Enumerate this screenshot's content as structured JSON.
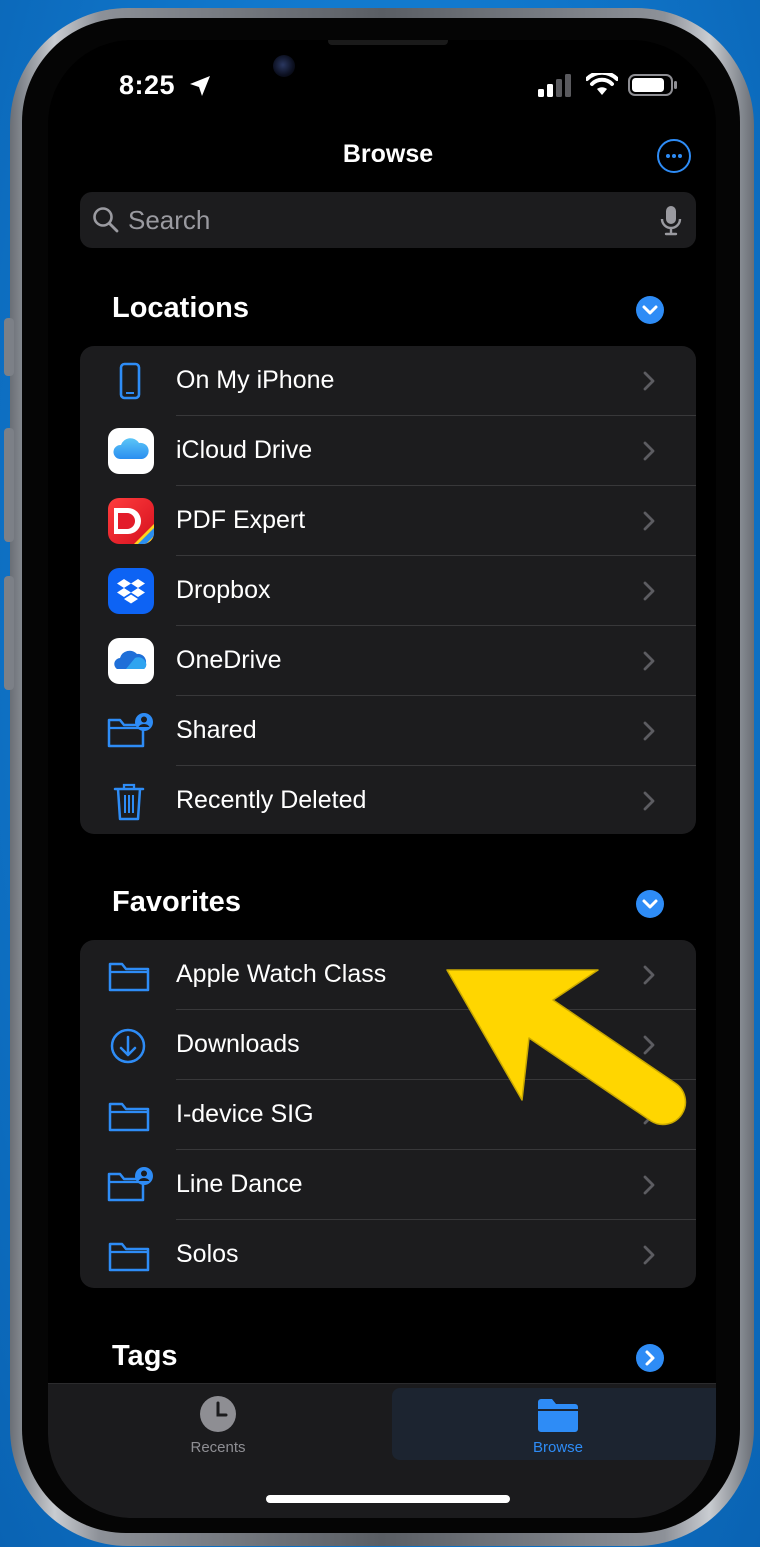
{
  "status_bar": {
    "time": "8:25"
  },
  "nav": {
    "title": "Browse"
  },
  "search": {
    "placeholder": "Search"
  },
  "locations": {
    "header": "Locations",
    "items": [
      {
        "label": "On My iPhone",
        "icon": "iphone-icon"
      },
      {
        "label": "iCloud Drive",
        "icon": "icloud-icon"
      },
      {
        "label": "PDF Expert",
        "icon": "pdf-expert-icon"
      },
      {
        "label": "Dropbox",
        "icon": "dropbox-icon"
      },
      {
        "label": "OneDrive",
        "icon": "onedrive-icon"
      },
      {
        "label": "Shared",
        "icon": "shared-folder-icon"
      },
      {
        "label": "Recently Deleted",
        "icon": "trash-icon"
      }
    ]
  },
  "favorites": {
    "header": "Favorites",
    "items": [
      {
        "label": "Apple Watch Class",
        "icon": "folder-icon"
      },
      {
        "label": "Downloads",
        "icon": "download-circle-icon"
      },
      {
        "label": "I-device SIG",
        "icon": "folder-icon"
      },
      {
        "label": "Line Dance",
        "icon": "shared-folder-icon"
      },
      {
        "label": "Solos",
        "icon": "folder-icon"
      }
    ]
  },
  "tags": {
    "header": "Tags"
  },
  "tabbar": {
    "recents": {
      "label": "Recents",
      "icon": "clock-icon"
    },
    "browse": {
      "label": "Browse",
      "icon": "folder-filled-icon"
    }
  },
  "colors": {
    "accent": "#2e8cf6",
    "arrow": "#ffd600",
    "row_bg": "#1c1c1e",
    "background": "#000000"
  }
}
